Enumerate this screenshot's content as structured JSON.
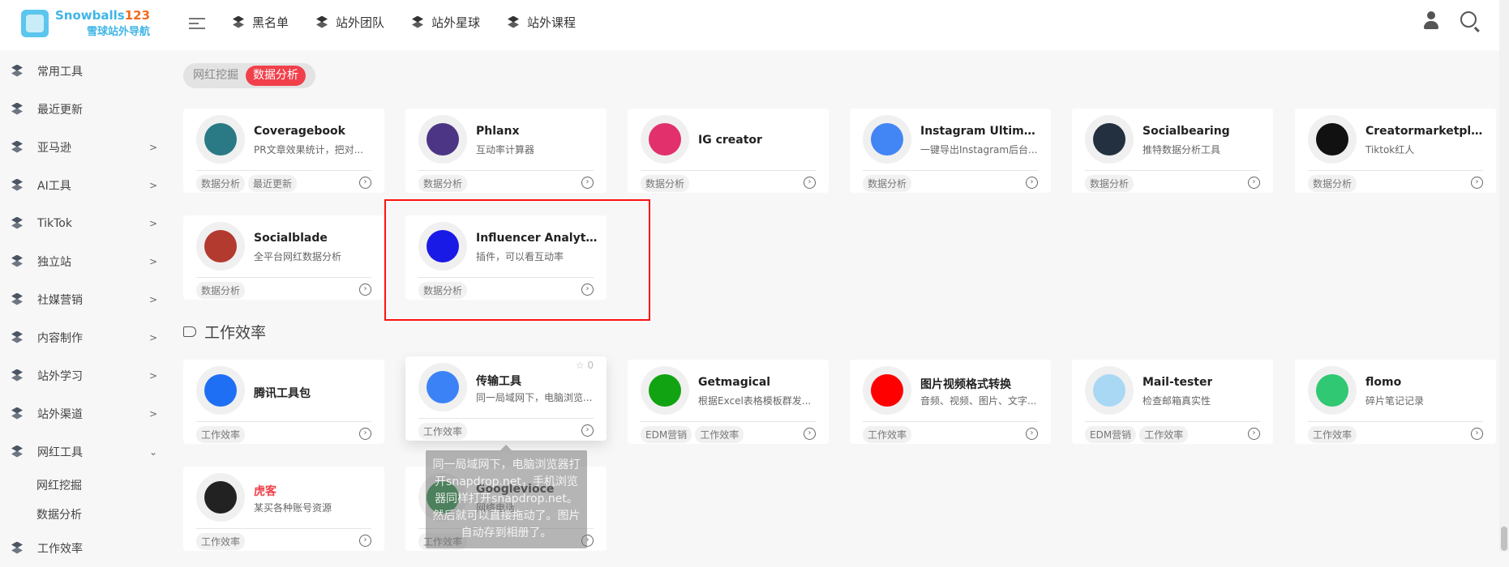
{
  "brand": {
    "name": "Snowballs",
    "num": "123",
    "sub": "雪球站外导航"
  },
  "topnav": [
    "黑名单",
    "站外团队",
    "站外星球",
    "站外课程"
  ],
  "sidebar": {
    "items": [
      {
        "label": "常用工具",
        "arrow": ""
      },
      {
        "label": "最近更新",
        "arrow": ""
      },
      {
        "label": "亚马逊",
        "arrow": ">"
      },
      {
        "label": "AI工具",
        "arrow": ">"
      },
      {
        "label": "TikTok",
        "arrow": ">"
      },
      {
        "label": "独立站",
        "arrow": ">"
      },
      {
        "label": "社媒营销",
        "arrow": ">"
      },
      {
        "label": "内容制作",
        "arrow": ">"
      },
      {
        "label": "站外学习",
        "arrow": ">"
      },
      {
        "label": "站外渠道",
        "arrow": ">"
      },
      {
        "label": "网红工具",
        "arrow": "⌄"
      }
    ],
    "sub": [
      "网红挖掘",
      "数据分析"
    ],
    "last": "工作效率"
  },
  "tabs": [
    "网红挖掘",
    "数据分析"
  ],
  "cards1": [
    {
      "title": "Coveragebook",
      "desc": "PR文章效果统计，把对...",
      "tags": [
        "数据分析",
        "最近更新"
      ],
      "color": "#2a7a86"
    },
    {
      "title": "Phlanx",
      "desc": "互动率计算器",
      "tags": [
        "数据分析"
      ],
      "color": "#4b3584"
    },
    {
      "title": "IG creator",
      "desc": "",
      "tags": [
        "数据分析"
      ],
      "color": "#e1306c"
    },
    {
      "title": "Instagram Ultimate ...",
      "desc": "一键导出Instagram后台...",
      "tags": [
        "数据分析"
      ],
      "color": "#4285f4"
    },
    {
      "title": "Socialbearing",
      "desc": "推特数据分析工具",
      "tags": [
        "数据分析"
      ],
      "color": "#233040"
    },
    {
      "title": "Creatormarketplace",
      "desc": "Tiktok红人",
      "tags": [
        "数据分析"
      ],
      "color": "#111"
    },
    {
      "title": "Socialblade",
      "desc": "全平台网红数据分析",
      "tags": [
        "数据分析"
      ],
      "color": "#b33a2e"
    },
    {
      "title": "Influencer Analytics...",
      "desc": "插件，可以看互动率",
      "tags": [
        "数据分析"
      ],
      "color": "#1a1ae6"
    }
  ],
  "section2": "工作效率",
  "cards2": [
    {
      "title": "腾讯工具包",
      "desc": "",
      "tags": [
        "工作效率"
      ],
      "color": "#1f6ff5"
    },
    {
      "title": "传输工具",
      "desc": "同一局域网下，电脑浏览...",
      "tags": [
        "工作效率"
      ],
      "color": "#3b82f6",
      "star": "☆ 0"
    },
    {
      "title": "Getmagical",
      "desc": "根据Excel表格模板群发...",
      "tags": [
        "EDM营销",
        "工作效率"
      ],
      "color": "#12a312"
    },
    {
      "title": "图片视频格式转换",
      "desc": "音频、视频、图片、文字...",
      "tags": [
        "工作效率"
      ],
      "color": "#ff0000"
    },
    {
      "title": "Mail-tester",
      "desc": "检查邮箱真实性",
      "tags": [
        "EDM营销",
        "工作效率"
      ],
      "color": "#a9d8f5"
    },
    {
      "title": "flomo",
      "desc": "碎片笔记记录",
      "tags": [
        "工作效率"
      ],
      "color": "#30c872"
    },
    {
      "title": "虎客",
      "desc": "某买各种账号资源",
      "tags": [
        "工作效率"
      ],
      "color": "#222"
    },
    {
      "title": "Googlevioce",
      "desc": "网络电话",
      "tags": [
        "工作效率"
      ],
      "color": "#1a8a3a"
    }
  ],
  "tooltip": "同一局域网下，电脑浏览器打开snapdrop.net，手机浏览器同样打开snapdrop.net。然后就可以直接拖动了。图片自动存到相册了。"
}
